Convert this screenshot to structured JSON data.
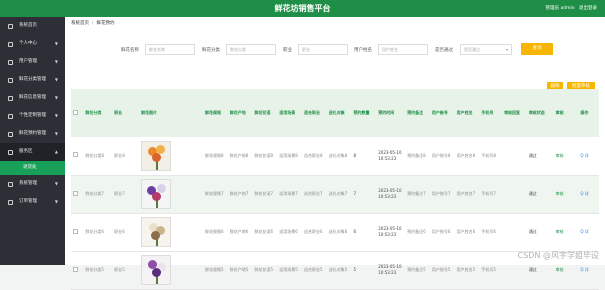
{
  "header": {
    "title": "鲜花坊销售平台",
    "user_text": "管理员 admin",
    "logout": "退出登录"
  },
  "sidebar": {
    "items": [
      {
        "label": "系统首页",
        "arrow": ""
      },
      {
        "label": "个人中心",
        "arrow": "▼"
      },
      {
        "label": "用户管理",
        "arrow": "▼"
      },
      {
        "label": "鲜花分类管理",
        "arrow": "▼"
      },
      {
        "label": "鲜花信息管理",
        "arrow": "▼"
      },
      {
        "label": "个性定制管理",
        "arrow": "▼"
      },
      {
        "label": "鲜花预约管理",
        "arrow": "▼"
      },
      {
        "label": "服务区",
        "arrow": "▲"
      }
    ],
    "sub_item": "退货处",
    "items_after": [
      {
        "label": "系统管理",
        "arrow": "▼"
      },
      {
        "label": "订单管理",
        "arrow": "▼"
      }
    ]
  },
  "breadcrumb": {
    "home": "系统首页",
    "sep": "/",
    "current": "鲜花预约"
  },
  "filters": {
    "flower_name": {
      "label": "鲜花名称",
      "placeholder": "鲜花名称"
    },
    "flower_category": {
      "label": "鲜花分类",
      "placeholder": "鲜花分类"
    },
    "occupation": {
      "label": "职业",
      "placeholder": "职业"
    },
    "user_name": {
      "label": "用户姓名",
      "placeholder": "用户姓名"
    },
    "approved": {
      "label": "是否通过",
      "placeholder": "是否通过"
    },
    "search_button": "查询"
  },
  "actions": {
    "delete": "删除",
    "batch_audit": "批量审核"
  },
  "table": {
    "columns": [
      "",
      "鲜花分类",
      "职业",
      "鲜花图片",
      "鲜花规格",
      "鲜花产地",
      "鲜花花语",
      "适用场景",
      "适合职业",
      "送礼对象",
      "预约数量",
      "预约时间",
      "预约备注",
      "用户账号",
      "用户姓名",
      "手机号",
      "审核回复",
      "审核状态",
      "审核",
      "操作"
    ],
    "rows": [
      {
        "category": "鲜花分类8",
        "job": "职业8",
        "spec": "鲜花规格8",
        "origin": "鲜花产地8",
        "lang": "鲜花花语8",
        "scene": "适用场景8",
        "suit": "适合职业8",
        "gift": "送礼对象8",
        "qty": "8",
        "time": "2023-05-10 10:53:23",
        "note": "预约备注8",
        "account": "用户账号8",
        "uname": "用户姓名8",
        "phone": "手机号8",
        "reply": "",
        "status": "通过",
        "audit": "审核",
        "op": "Q 详"
      },
      {
        "category": "鲜花分类7",
        "job": "职业7",
        "spec": "鲜花规格7",
        "origin": "鲜花产地7",
        "lang": "鲜花花语7",
        "scene": "适用场景7",
        "suit": "适合职业7",
        "gift": "送礼对象7",
        "qty": "7",
        "time": "2023-05-10 10:53:23",
        "note": "预约备注7",
        "account": "用户账号7",
        "uname": "用户姓名7",
        "phone": "手机号7",
        "reply": "",
        "status": "通过",
        "audit": "审核",
        "op": "Q 详"
      },
      {
        "category": "鲜花分类6",
        "job": "职业6",
        "spec": "鲜花规格6",
        "origin": "鲜花产地6",
        "lang": "鲜花花语6",
        "scene": "适用场景6",
        "suit": "适合职业6",
        "gift": "送礼对象6",
        "qty": "6",
        "time": "2023-05-10 10:53:23",
        "note": "预约备注6",
        "account": "用户账号6",
        "uname": "用户姓名6",
        "phone": "手机号6",
        "reply": "",
        "status": "通过",
        "audit": "审核",
        "op": "Q 详"
      },
      {
        "category": "鲜花分类5",
        "job": "职业5",
        "spec": "鲜花规格5",
        "origin": "鲜花产地5",
        "lang": "鲜花花语5",
        "scene": "适用场景5",
        "suit": "适合职业5",
        "gift": "送礼对象5",
        "qty": "5",
        "time": "2023-05-10 10:53:23",
        "note": "预约备注5",
        "account": "用户账号5",
        "uname": "用户姓名5",
        "phone": "手机号5",
        "reply": "",
        "status": "通过",
        "audit": "审核",
        "op": "Q 详"
      }
    ]
  },
  "watermark": "CSDN @风宇学姐毕设",
  "colors": {
    "brand": "#1f8f47",
    "accent": "#f7b500",
    "sidebar": "#2c2f35"
  }
}
